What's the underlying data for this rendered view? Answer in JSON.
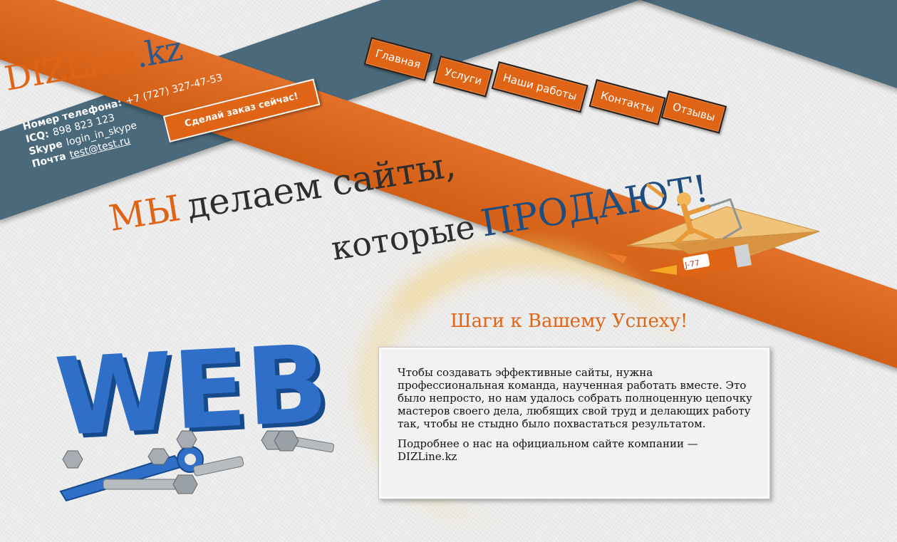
{
  "logo": {
    "part1": "DIZLine",
    "part2": ".kz"
  },
  "contacts": {
    "phone_label": "Номер телефона:",
    "phone": "+7 (727) 327-47-53",
    "icq_label": "ICQ:",
    "icq": "898 823 123",
    "skype_label": "Skype",
    "skype": "login_in_skype",
    "mail_label": "Почта",
    "mail": "test@test.ru"
  },
  "order_button": "Сделай заказ сейчас!",
  "nav": {
    "items": [
      "Главная",
      "Услуги",
      "Наши работы",
      "Контакты",
      "Отзывы"
    ]
  },
  "headline": {
    "line1_a": "МЫ",
    "line1_b": "делаем сайты,",
    "line2_a": "которые",
    "line2_b": "ПРОДАЮТ!"
  },
  "rocket": {
    "label": "J-77"
  },
  "art": {
    "word": "WEB"
  },
  "section": {
    "title": "Шаги к Вашему Успеху!",
    "p1": "Чтобы создавать эффективные сайты, нужна профессиональная команда, наученная работать вместе. Это было непросто, но нам удалось собрать полноценную цепочку мастеров своего дела, любящих свой труд и делающих работу так, чтобы не стыдно было похвастаться результатом.",
    "p2": "Подробнее о нас на официальном сайте компании — DIZLine.kz"
  },
  "colors": {
    "orange": "#e06416",
    "slate": "#4a6a7c",
    "navy": "#1e4e80",
    "web_blue": "#2f6fc7"
  }
}
